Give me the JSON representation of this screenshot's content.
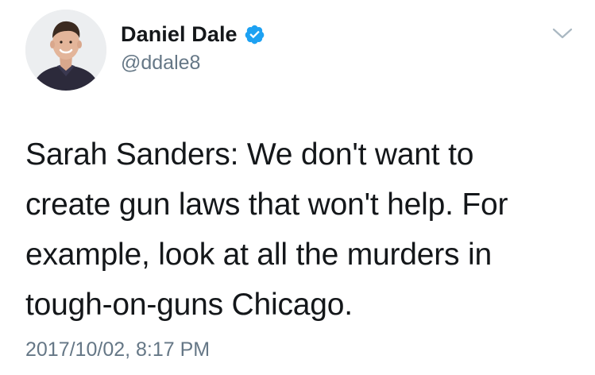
{
  "author": {
    "display_name": "Daniel Dale",
    "handle": "@ddale8",
    "verified": true,
    "avatar_icon": "profile-photo"
  },
  "tweet": {
    "text": "Sarah Sanders: We don't want to create gun laws that won't help. For example, look at all the murders in tough-on-guns Chicago.",
    "timestamp": "2017/10/02, 8:17 PM"
  },
  "menu": {
    "icon": "chevron-down-icon"
  },
  "colors": {
    "verified_badge": "#1da1f2",
    "secondary_text": "#657786",
    "primary_text": "#14171a"
  }
}
